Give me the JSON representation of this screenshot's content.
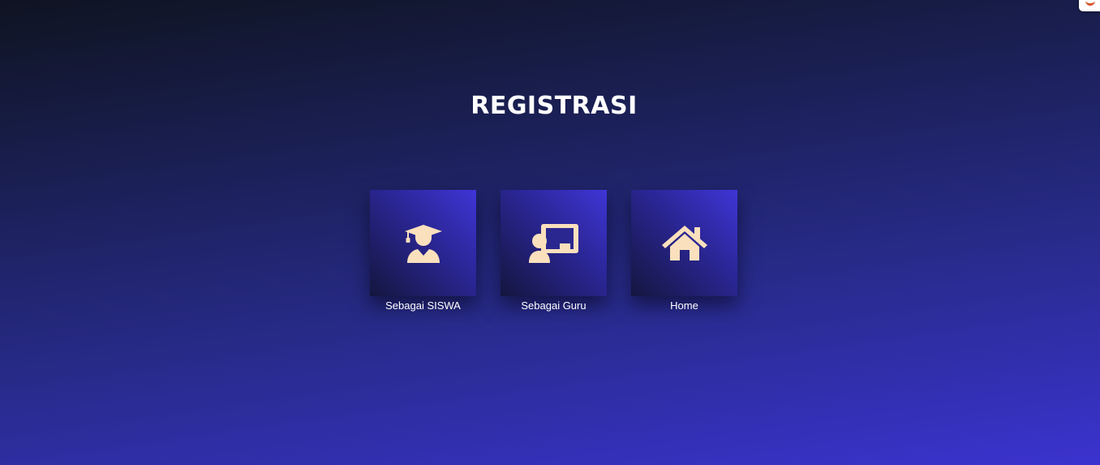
{
  "page": {
    "title": "REGISTRASI"
  },
  "options": [
    {
      "label": "Sebagai SISWA",
      "icon": "student-graduate-icon"
    },
    {
      "label": "Sebagai Guru",
      "icon": "teacher-chalkboard-icon"
    },
    {
      "label": "Home",
      "icon": "home-icon"
    }
  ],
  "colors": {
    "background_top": "#0f1422",
    "background_bottom": "#3b33cf",
    "tile_accent": "#3f35d6",
    "icon_color": "#fbe0bd",
    "text": "#ffffff"
  }
}
